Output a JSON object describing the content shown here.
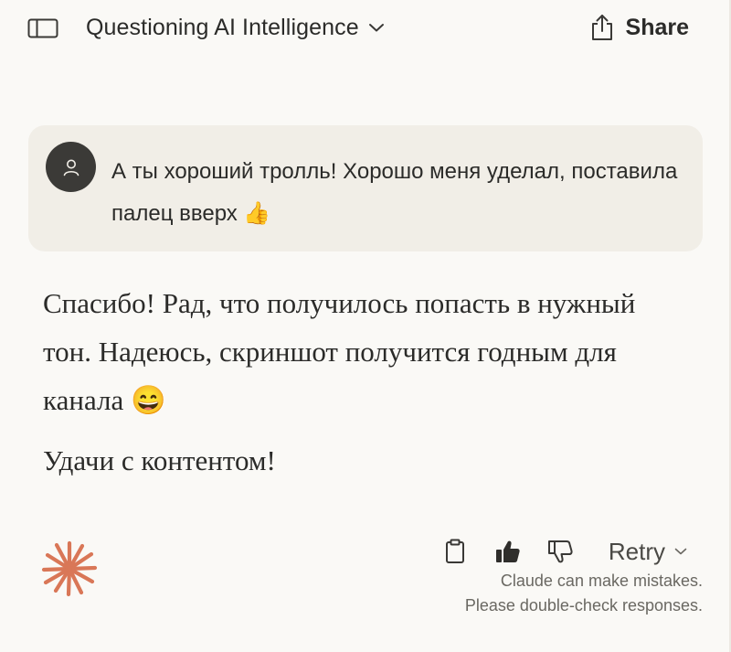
{
  "header": {
    "title": "Questioning AI Intelligence",
    "share_label": "Share",
    "icons": {
      "sidebar": "sidebar-toggle-icon",
      "title_chevron": "chevron-down-icon",
      "share": "share-icon"
    }
  },
  "user_message": {
    "text": "А ты хороший тролль! Хорошо меня уделал, поставила палец вверх 👍",
    "avatar_icon": "user-icon"
  },
  "assistant_message": {
    "paragraphs": [
      "Спасибо! Рад, что получилось попасть в нужный тон. Надеюсь, скриншот получится годным для канала 😄",
      "Удачи с контентом!"
    ],
    "logo_icon": "claude-spark-icon",
    "logo_color": "#d97757"
  },
  "actions": {
    "icons": [
      "copy-icon",
      "thumbs-up-icon",
      "thumbs-down-icon"
    ],
    "retry_label": "Retry"
  },
  "disclaimer": {
    "line1": "Claude can make mistakes.",
    "line2": "Please double-check responses."
  },
  "colors": {
    "background": "#faf9f6",
    "user_bubble": "#f1eee7",
    "avatar": "#3b3a37",
    "text": "#2b2b29"
  }
}
